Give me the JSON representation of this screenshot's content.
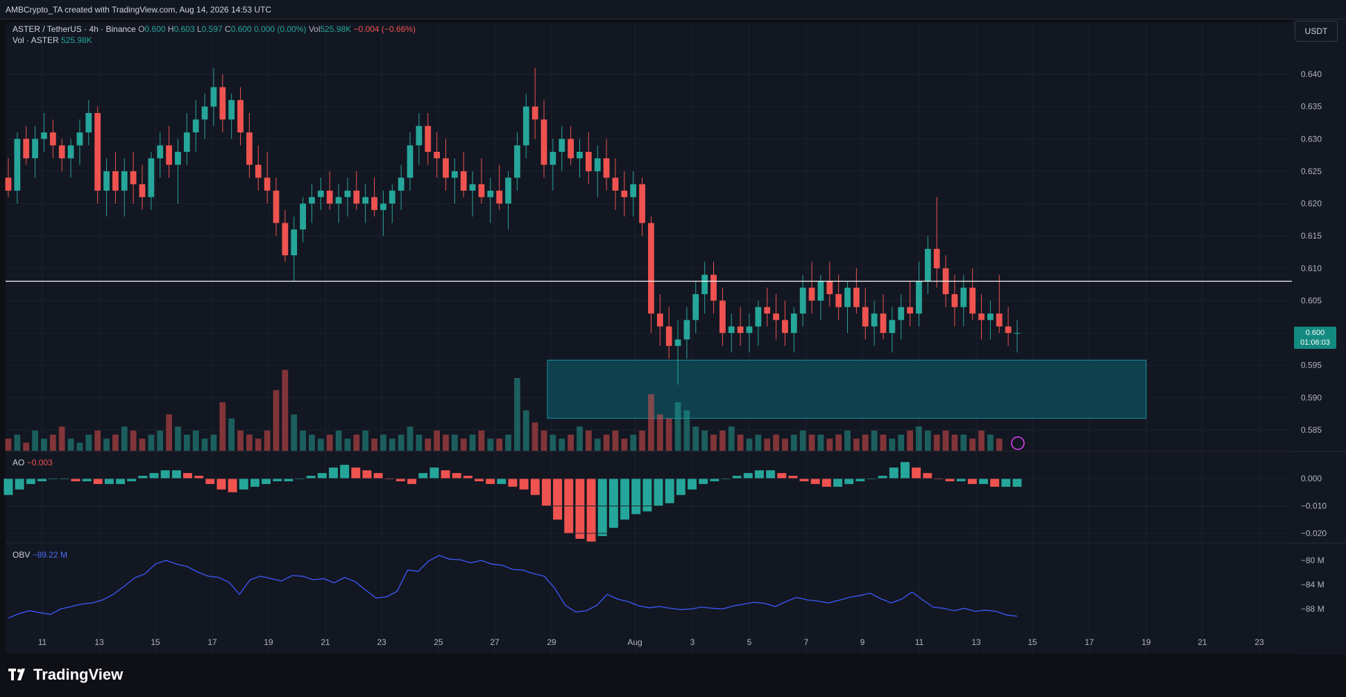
{
  "header": {
    "attribution": "AMBCrypto_TA created with TradingView.com, Aug 14, 2026 14:53 UTC"
  },
  "legend": {
    "symbol": "ASTER / TetherUS · 4h · Binance",
    "o_label": "O",
    "o": "0.600",
    "h_label": "H",
    "h": "0.603",
    "l_label": "L",
    "l": "0.597",
    "c_label": "C",
    "c": "0.600",
    "change": "0.000 (0.00%)",
    "vol_label": "Vol",
    "vol": "525.98K",
    "vol_change": "−0.004 (−0.66%)",
    "vol_line_label": "Vol · ASTER",
    "vol_line_value": "525.98K",
    "ao_label": "AO",
    "ao_value": "−0.003",
    "obv_label": "OBV",
    "obv_value": "−89.22 M"
  },
  "currency_button": "USDT",
  "price_tag": {
    "price": "0.600",
    "countdown": "01:06:03"
  },
  "footer": {
    "logo_text": "TradingView",
    "logo_icon": "tradingview-logo-icon"
  },
  "colors": {
    "up": "#26a69a",
    "down": "#ef5350",
    "zone": "#0d4f5c",
    "obv": "#3d5afe",
    "bg": "#131722"
  },
  "chart_data": [
    {
      "type": "candlestick",
      "title": "ASTER / TetherUS · 4h · Binance",
      "ylim": [
        0.582,
        0.645
      ],
      "y_ticks": [
        "0.640",
        "0.635",
        "0.630",
        "0.625",
        "0.620",
        "0.615",
        "0.610",
        "0.605",
        "0.600",
        "0.595",
        "0.590",
        "0.585"
      ],
      "x_ticks": [
        "11",
        "13",
        "15",
        "17",
        "19",
        "21",
        "23",
        "25",
        "27",
        "29",
        "Aug",
        "3",
        "5",
        "7",
        "9",
        "11",
        "13",
        "15",
        "17",
        "19",
        "21",
        "23"
      ],
      "horizontal_line": 0.608,
      "support_zone": {
        "from_date": "Jul 29",
        "to_date": "Aug 19",
        "low": 0.5868,
        "high": 0.5958
      },
      "ohlc": [
        [
          0.624,
          0.627,
          0.621,
          0.622
        ],
        [
          0.622,
          0.631,
          0.62,
          0.63
        ],
        [
          0.63,
          0.632,
          0.626,
          0.627
        ],
        [
          0.627,
          0.632,
          0.624,
          0.63
        ],
        [
          0.63,
          0.634,
          0.628,
          0.631
        ],
        [
          0.631,
          0.633,
          0.627,
          0.629
        ],
        [
          0.629,
          0.63,
          0.625,
          0.627
        ],
        [
          0.627,
          0.63,
          0.624,
          0.629
        ],
        [
          0.629,
          0.633,
          0.626,
          0.631
        ],
        [
          0.631,
          0.636,
          0.629,
          0.634
        ],
        [
          0.634,
          0.635,
          0.62,
          0.622
        ],
        [
          0.622,
          0.627,
          0.618,
          0.625
        ],
        [
          0.625,
          0.628,
          0.62,
          0.622
        ],
        [
          0.622,
          0.627,
          0.618,
          0.625
        ],
        [
          0.625,
          0.628,
          0.62,
          0.623
        ],
        [
          0.623,
          0.626,
          0.619,
          0.621
        ],
        [
          0.621,
          0.628,
          0.619,
          0.627
        ],
        [
          0.627,
          0.631,
          0.624,
          0.629
        ],
        [
          0.629,
          0.632,
          0.624,
          0.626
        ],
        [
          0.626,
          0.63,
          0.62,
          0.628
        ],
        [
          0.628,
          0.634,
          0.626,
          0.631
        ],
        [
          0.631,
          0.636,
          0.628,
          0.633
        ],
        [
          0.633,
          0.637,
          0.63,
          0.635
        ],
        [
          0.635,
          0.641,
          0.632,
          0.638
        ],
        [
          0.638,
          0.64,
          0.631,
          0.633
        ],
        [
          0.633,
          0.637,
          0.63,
          0.636
        ],
        [
          0.636,
          0.638,
          0.629,
          0.631
        ],
        [
          0.631,
          0.634,
          0.624,
          0.626
        ],
        [
          0.626,
          0.629,
          0.622,
          0.624
        ],
        [
          0.624,
          0.628,
          0.62,
          0.622
        ],
        [
          0.622,
          0.624,
          0.615,
          0.617
        ],
        [
          0.617,
          0.619,
          0.611,
          0.612
        ],
        [
          0.612,
          0.618,
          0.608,
          0.616
        ],
        [
          0.616,
          0.621,
          0.614,
          0.62
        ],
        [
          0.62,
          0.623,
          0.617,
          0.621
        ],
        [
          0.621,
          0.624,
          0.619,
          0.622
        ],
        [
          0.622,
          0.625,
          0.619,
          0.62
        ],
        [
          0.62,
          0.623,
          0.617,
          0.621
        ],
        [
          0.621,
          0.624,
          0.618,
          0.622
        ],
        [
          0.622,
          0.625,
          0.619,
          0.62
        ],
        [
          0.62,
          0.623,
          0.617,
          0.621
        ],
        [
          0.621,
          0.624,
          0.618,
          0.619
        ],
        [
          0.619,
          0.622,
          0.615,
          0.62
        ],
        [
          0.62,
          0.623,
          0.617,
          0.622
        ],
        [
          0.622,
          0.626,
          0.619,
          0.624
        ],
        [
          0.624,
          0.631,
          0.622,
          0.629
        ],
        [
          0.629,
          0.634,
          0.626,
          0.632
        ],
        [
          0.632,
          0.634,
          0.626,
          0.628
        ],
        [
          0.628,
          0.631,
          0.624,
          0.627
        ],
        [
          0.627,
          0.63,
          0.622,
          0.624
        ],
        [
          0.624,
          0.627,
          0.62,
          0.625
        ],
        [
          0.625,
          0.628,
          0.621,
          0.622
        ],
        [
          0.622,
          0.625,
          0.618,
          0.623
        ],
        [
          0.623,
          0.627,
          0.62,
          0.621
        ],
        [
          0.621,
          0.624,
          0.617,
          0.622
        ],
        [
          0.622,
          0.626,
          0.619,
          0.62
        ],
        [
          0.62,
          0.625,
          0.616,
          0.624
        ],
        [
          0.624,
          0.631,
          0.622,
          0.629
        ],
        [
          0.629,
          0.637,
          0.627,
          0.635
        ],
        [
          0.635,
          0.641,
          0.63,
          0.633
        ],
        [
          0.633,
          0.636,
          0.624,
          0.626
        ],
        [
          0.626,
          0.63,
          0.622,
          0.628
        ],
        [
          0.628,
          0.632,
          0.625,
          0.63
        ],
        [
          0.63,
          0.632,
          0.626,
          0.627
        ],
        [
          0.627,
          0.63,
          0.624,
          0.628
        ],
        [
          0.628,
          0.631,
          0.623,
          0.625
        ],
        [
          0.625,
          0.629,
          0.621,
          0.627
        ],
        [
          0.627,
          0.63,
          0.622,
          0.624
        ],
        [
          0.624,
          0.627,
          0.619,
          0.622
        ],
        [
          0.622,
          0.625,
          0.618,
          0.621
        ],
        [
          0.621,
          0.625,
          0.618,
          0.623
        ],
        [
          0.623,
          0.624,
          0.615,
          0.617
        ],
        [
          0.617,
          0.618,
          0.6,
          0.603
        ],
        [
          0.603,
          0.606,
          0.598,
          0.601
        ],
        [
          0.601,
          0.604,
          0.596,
          0.598
        ],
        [
          0.598,
          0.602,
          0.592,
          0.599
        ],
        [
          0.599,
          0.604,
          0.596,
          0.602
        ],
        [
          0.602,
          0.608,
          0.6,
          0.606
        ],
        [
          0.606,
          0.611,
          0.603,
          0.609
        ],
        [
          0.609,
          0.611,
          0.603,
          0.605
        ],
        [
          0.605,
          0.607,
          0.598,
          0.6
        ],
        [
          0.6,
          0.603,
          0.597,
          0.601
        ],
        [
          0.601,
          0.604,
          0.598,
          0.6
        ],
        [
          0.6,
          0.603,
          0.597,
          0.601
        ],
        [
          0.601,
          0.605,
          0.598,
          0.604
        ],
        [
          0.604,
          0.607,
          0.601,
          0.603
        ],
        [
          0.603,
          0.606,
          0.599,
          0.602
        ],
        [
          0.602,
          0.605,
          0.598,
          0.6
        ],
        [
          0.6,
          0.604,
          0.597,
          0.603
        ],
        [
          0.603,
          0.609,
          0.601,
          0.607
        ],
        [
          0.607,
          0.611,
          0.603,
          0.605
        ],
        [
          0.605,
          0.609,
          0.602,
          0.608
        ],
        [
          0.608,
          0.611,
          0.604,
          0.606
        ],
        [
          0.606,
          0.609,
          0.602,
          0.604
        ],
        [
          0.604,
          0.608,
          0.6,
          0.607
        ],
        [
          0.607,
          0.61,
          0.603,
          0.604
        ],
        [
          0.604,
          0.607,
          0.599,
          0.601
        ],
        [
          0.601,
          0.605,
          0.598,
          0.603
        ],
        [
          0.603,
          0.606,
          0.599,
          0.6
        ],
        [
          0.6,
          0.604,
          0.597,
          0.602
        ],
        [
          0.602,
          0.606,
          0.599,
          0.604
        ],
        [
          0.604,
          0.608,
          0.601,
          0.603
        ],
        [
          0.603,
          0.611,
          0.601,
          0.608
        ],
        [
          0.608,
          0.615,
          0.606,
          0.613
        ],
        [
          0.613,
          0.621,
          0.607,
          0.61
        ],
        [
          0.61,
          0.612,
          0.604,
          0.606
        ],
        [
          0.606,
          0.609,
          0.601,
          0.604
        ],
        [
          0.604,
          0.609,
          0.601,
          0.607
        ],
        [
          0.607,
          0.61,
          0.602,
          0.603
        ],
        [
          0.603,
          0.606,
          0.599,
          0.602
        ],
        [
          0.602,
          0.605,
          0.599,
          0.603
        ],
        [
          0.603,
          0.609,
          0.6,
          0.601
        ],
        [
          0.601,
          0.604,
          0.598,
          0.6
        ],
        [
          0.6,
          0.602,
          0.597,
          0.6
        ]
      ]
    },
    {
      "type": "bar",
      "title": "Vol · ASTER",
      "values": [
        3,
        4,
        2,
        5,
        3,
        4,
        6,
        3,
        2,
        4,
        5,
        3,
        4,
        6,
        5,
        3,
        4,
        5,
        9,
        6,
        4,
        5,
        3,
        4,
        12,
        8,
        5,
        4,
        3,
        5,
        15,
        20,
        9,
        5,
        4,
        3,
        4,
        5,
        3,
        4,
        5,
        3,
        4,
        3,
        4,
        6,
        4,
        3,
        5,
        4,
        4,
        3,
        4,
        5,
        3,
        3,
        4,
        18,
        10,
        7,
        5,
        4,
        3,
        4,
        6,
        5,
        3,
        4,
        5,
        3,
        4,
        5,
        14,
        9,
        8,
        12,
        10,
        6,
        5,
        4,
        5,
        6,
        4,
        3,
        4,
        3,
        4,
        3,
        4,
        5,
        4,
        4,
        3,
        4,
        5,
        3,
        4,
        5,
        4,
        3,
        4,
        5,
        6,
        5,
        4,
        5,
        4,
        4,
        3,
        5,
        4,
        3
      ],
      "ylim": [
        0,
        30
      ]
    },
    {
      "type": "bar",
      "title": "AO",
      "y_ticks": [
        "0.000",
        "−0.010",
        "−0.020"
      ],
      "ylim": [
        -0.025,
        0.008
      ],
      "values": [
        -0.006,
        -0.004,
        -0.002,
        -0.001,
        0.0,
        0.0,
        -0.001,
        -0.001,
        -0.002,
        -0.002,
        -0.002,
        -0.001,
        0.001,
        0.002,
        0.003,
        0.003,
        0.002,
        0.001,
        -0.002,
        -0.004,
        -0.005,
        -0.004,
        -0.003,
        -0.002,
        -0.001,
        -0.001,
        0.0,
        0.001,
        0.002,
        0.004,
        0.005,
        0.004,
        0.003,
        0.002,
        0.0,
        -0.001,
        -0.002,
        0.002,
        0.004,
        0.003,
        0.002,
        0.001,
        -0.001,
        -0.002,
        -0.002,
        -0.003,
        -0.004,
        -0.006,
        -0.01,
        -0.015,
        -0.02,
        -0.022,
        -0.023,
        -0.021,
        -0.018,
        -0.015,
        -0.013,
        -0.012,
        -0.01,
        -0.009,
        -0.006,
        -0.004,
        -0.002,
        -0.001,
        0.0,
        0.001,
        0.002,
        0.003,
        0.003,
        0.002,
        0.001,
        -0.001,
        -0.002,
        -0.003,
        -0.003,
        -0.002,
        -0.001,
        0.0,
        0.001,
        0.004,
        0.006,
        0.004,
        0.002,
        0.0,
        -0.001,
        -0.001,
        -0.002,
        -0.002,
        -0.003,
        -0.003,
        -0.003
      ],
      "colors_by_sign": {
        "rising": "#26a69a",
        "falling": "#ef5350"
      }
    },
    {
      "type": "line",
      "title": "OBV",
      "y_ticks": [
        "−80 M",
        "−84 M",
        "−88 M"
      ],
      "ylim": [
        -90.5,
        -78.5
      ],
      "values": [
        -89.5,
        -88.8,
        -88.3,
        -88.6,
        -88.9,
        -88.0,
        -87.6,
        -87.2,
        -87.0,
        -86.5,
        -85.6,
        -84.3,
        -82.9,
        -82.2,
        -80.6,
        -80.0,
        -80.6,
        -81.0,
        -81.9,
        -82.6,
        -82.8,
        -83.6,
        -85.6,
        -83.2,
        -82.6,
        -83.0,
        -83.4,
        -82.5,
        -82.6,
        -83.2,
        -83.0,
        -83.7,
        -82.8,
        -83.5,
        -84.9,
        -86.2,
        -86.0,
        -85.1,
        -81.6,
        -81.8,
        -80.1,
        -79.2,
        -79.8,
        -79.9,
        -80.4,
        -80.0,
        -80.6,
        -80.8,
        -81.5,
        -81.6,
        -82.2,
        -82.6,
        -84.6,
        -87.4,
        -88.5,
        -88.3,
        -87.4,
        -85.6,
        -86.4,
        -86.8,
        -87.5,
        -87.8,
        -87.6,
        -87.9,
        -88.1,
        -88.0,
        -87.7,
        -87.9,
        -88.0,
        -87.5,
        -87.2,
        -86.9,
        -87.1,
        -87.6,
        -86.8,
        -86.1,
        -86.5,
        -86.7,
        -87.0,
        -86.6,
        -86.1,
        -85.8,
        -85.4,
        -86.3,
        -87.0,
        -86.4,
        -85.2,
        -86.5,
        -87.7,
        -87.9,
        -88.3,
        -87.9,
        -88.4,
        -88.2,
        -88.4,
        -89.0,
        -89.2
      ]
    }
  ]
}
